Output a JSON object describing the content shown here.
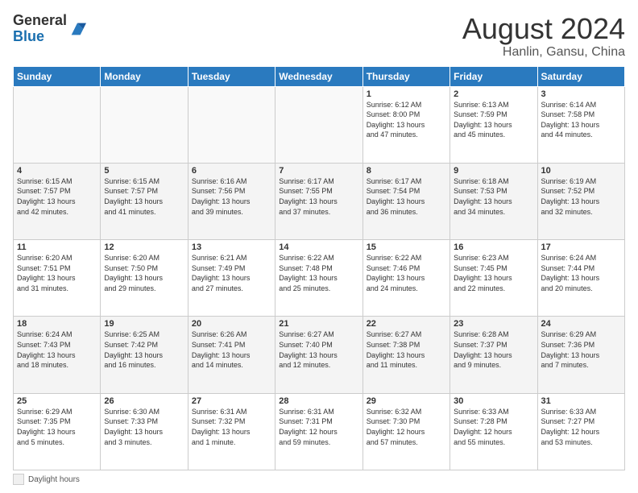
{
  "header": {
    "logo_general": "General",
    "logo_blue": "Blue",
    "month_year": "August 2024",
    "location": "Hanlin, Gansu, China"
  },
  "calendar": {
    "days_of_week": [
      "Sunday",
      "Monday",
      "Tuesday",
      "Wednesday",
      "Thursday",
      "Friday",
      "Saturday"
    ],
    "weeks": [
      [
        {
          "day": "",
          "info": ""
        },
        {
          "day": "",
          "info": ""
        },
        {
          "day": "",
          "info": ""
        },
        {
          "day": "",
          "info": ""
        },
        {
          "day": "1",
          "info": "Sunrise: 6:12 AM\nSunset: 8:00 PM\nDaylight: 13 hours\nand 47 minutes."
        },
        {
          "day": "2",
          "info": "Sunrise: 6:13 AM\nSunset: 7:59 PM\nDaylight: 13 hours\nand 45 minutes."
        },
        {
          "day": "3",
          "info": "Sunrise: 6:14 AM\nSunset: 7:58 PM\nDaylight: 13 hours\nand 44 minutes."
        }
      ],
      [
        {
          "day": "4",
          "info": "Sunrise: 6:15 AM\nSunset: 7:57 PM\nDaylight: 13 hours\nand 42 minutes."
        },
        {
          "day": "5",
          "info": "Sunrise: 6:15 AM\nSunset: 7:57 PM\nDaylight: 13 hours\nand 41 minutes."
        },
        {
          "day": "6",
          "info": "Sunrise: 6:16 AM\nSunset: 7:56 PM\nDaylight: 13 hours\nand 39 minutes."
        },
        {
          "day": "7",
          "info": "Sunrise: 6:17 AM\nSunset: 7:55 PM\nDaylight: 13 hours\nand 37 minutes."
        },
        {
          "day": "8",
          "info": "Sunrise: 6:17 AM\nSunset: 7:54 PM\nDaylight: 13 hours\nand 36 minutes."
        },
        {
          "day": "9",
          "info": "Sunrise: 6:18 AM\nSunset: 7:53 PM\nDaylight: 13 hours\nand 34 minutes."
        },
        {
          "day": "10",
          "info": "Sunrise: 6:19 AM\nSunset: 7:52 PM\nDaylight: 13 hours\nand 32 minutes."
        }
      ],
      [
        {
          "day": "11",
          "info": "Sunrise: 6:20 AM\nSunset: 7:51 PM\nDaylight: 13 hours\nand 31 minutes."
        },
        {
          "day": "12",
          "info": "Sunrise: 6:20 AM\nSunset: 7:50 PM\nDaylight: 13 hours\nand 29 minutes."
        },
        {
          "day": "13",
          "info": "Sunrise: 6:21 AM\nSunset: 7:49 PM\nDaylight: 13 hours\nand 27 minutes."
        },
        {
          "day": "14",
          "info": "Sunrise: 6:22 AM\nSunset: 7:48 PM\nDaylight: 13 hours\nand 25 minutes."
        },
        {
          "day": "15",
          "info": "Sunrise: 6:22 AM\nSunset: 7:46 PM\nDaylight: 13 hours\nand 24 minutes."
        },
        {
          "day": "16",
          "info": "Sunrise: 6:23 AM\nSunset: 7:45 PM\nDaylight: 13 hours\nand 22 minutes."
        },
        {
          "day": "17",
          "info": "Sunrise: 6:24 AM\nSunset: 7:44 PM\nDaylight: 13 hours\nand 20 minutes."
        }
      ],
      [
        {
          "day": "18",
          "info": "Sunrise: 6:24 AM\nSunset: 7:43 PM\nDaylight: 13 hours\nand 18 minutes."
        },
        {
          "day": "19",
          "info": "Sunrise: 6:25 AM\nSunset: 7:42 PM\nDaylight: 13 hours\nand 16 minutes."
        },
        {
          "day": "20",
          "info": "Sunrise: 6:26 AM\nSunset: 7:41 PM\nDaylight: 13 hours\nand 14 minutes."
        },
        {
          "day": "21",
          "info": "Sunrise: 6:27 AM\nSunset: 7:40 PM\nDaylight: 13 hours\nand 12 minutes."
        },
        {
          "day": "22",
          "info": "Sunrise: 6:27 AM\nSunset: 7:38 PM\nDaylight: 13 hours\nand 11 minutes."
        },
        {
          "day": "23",
          "info": "Sunrise: 6:28 AM\nSunset: 7:37 PM\nDaylight: 13 hours\nand 9 minutes."
        },
        {
          "day": "24",
          "info": "Sunrise: 6:29 AM\nSunset: 7:36 PM\nDaylight: 13 hours\nand 7 minutes."
        }
      ],
      [
        {
          "day": "25",
          "info": "Sunrise: 6:29 AM\nSunset: 7:35 PM\nDaylight: 13 hours\nand 5 minutes."
        },
        {
          "day": "26",
          "info": "Sunrise: 6:30 AM\nSunset: 7:33 PM\nDaylight: 13 hours\nand 3 minutes."
        },
        {
          "day": "27",
          "info": "Sunrise: 6:31 AM\nSunset: 7:32 PM\nDaylight: 13 hours\nand 1 minute."
        },
        {
          "day": "28",
          "info": "Sunrise: 6:31 AM\nSunset: 7:31 PM\nDaylight: 12 hours\nand 59 minutes."
        },
        {
          "day": "29",
          "info": "Sunrise: 6:32 AM\nSunset: 7:30 PM\nDaylight: 12 hours\nand 57 minutes."
        },
        {
          "day": "30",
          "info": "Sunrise: 6:33 AM\nSunset: 7:28 PM\nDaylight: 12 hours\nand 55 minutes."
        },
        {
          "day": "31",
          "info": "Sunrise: 6:33 AM\nSunset: 7:27 PM\nDaylight: 12 hours\nand 53 minutes."
        }
      ]
    ]
  },
  "footer": {
    "legend_label": "Daylight hours"
  }
}
